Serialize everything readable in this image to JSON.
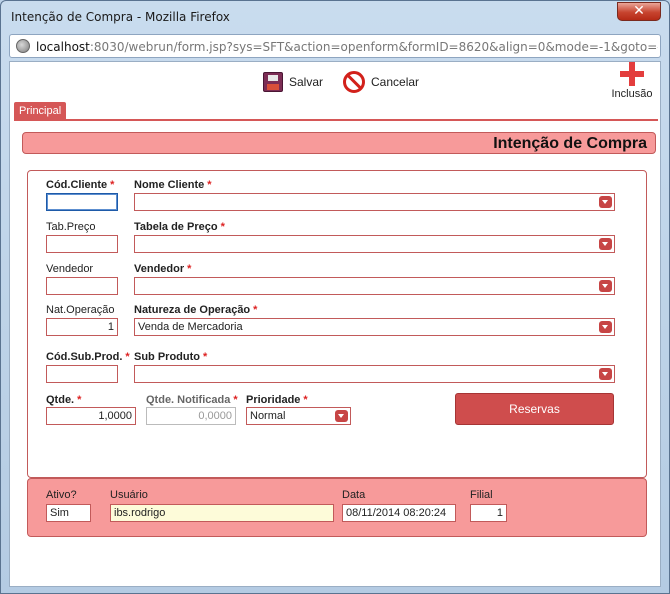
{
  "window": {
    "title": "Intenção de Compra - Mozilla Firefox",
    "close_glyph": "✕"
  },
  "urlbar": {
    "host": "localhost",
    "rest": ":8030/webrun/form.jsp?sys=SFT&action=openform&formID=8620&align=0&mode=-1&goto=-1&filter=&"
  },
  "toolbar": {
    "save_label": "Salvar",
    "cancel_label": "Cancelar",
    "add_label": "Inclusão"
  },
  "tab": {
    "label": "Principal"
  },
  "header": {
    "title": "Intenção de Compra"
  },
  "required_mark": "*",
  "form": {
    "cod_cliente": {
      "label": "Cód.Cliente",
      "value": ""
    },
    "nome_cliente": {
      "label": "Nome Cliente",
      "value": ""
    },
    "tab_preco": {
      "label": "Tab.Preço",
      "value": ""
    },
    "tabela_preco": {
      "label": "Tabela de Preço",
      "value": ""
    },
    "vendedor_code": {
      "label": "Vendedor",
      "value": ""
    },
    "vendedor": {
      "label": "Vendedor",
      "value": ""
    },
    "nat_operacao": {
      "label": "Nat.Operação",
      "value": "1"
    },
    "natureza_operacao": {
      "label": "Natureza de Operação",
      "value": "Venda de Mercadoria"
    },
    "cod_sub_prod": {
      "label": "Cód.Sub.Prod.",
      "value": ""
    },
    "sub_produto": {
      "label": "Sub Produto",
      "value": ""
    },
    "qtde": {
      "label": "Qtde.",
      "value": "1,0000"
    },
    "qtde_notificada": {
      "label": "Qtde. Notificada",
      "value": "0,0000"
    },
    "prioridade": {
      "label": "Prioridade",
      "value": "Normal"
    },
    "reservas_label": "Reservas"
  },
  "footer": {
    "ativo": {
      "label": "Ativo?",
      "value": "Sim"
    },
    "usuario": {
      "label": "Usuário",
      "value": "ibs.rodrigo"
    },
    "data": {
      "label": "Data",
      "value": "08/11/2014 08:20:24"
    },
    "filial": {
      "label": "Filial",
      "value": "1"
    }
  },
  "colors": {
    "accent": "#d55757",
    "panel": "#f79a9a",
    "border": "#c25a5a"
  }
}
